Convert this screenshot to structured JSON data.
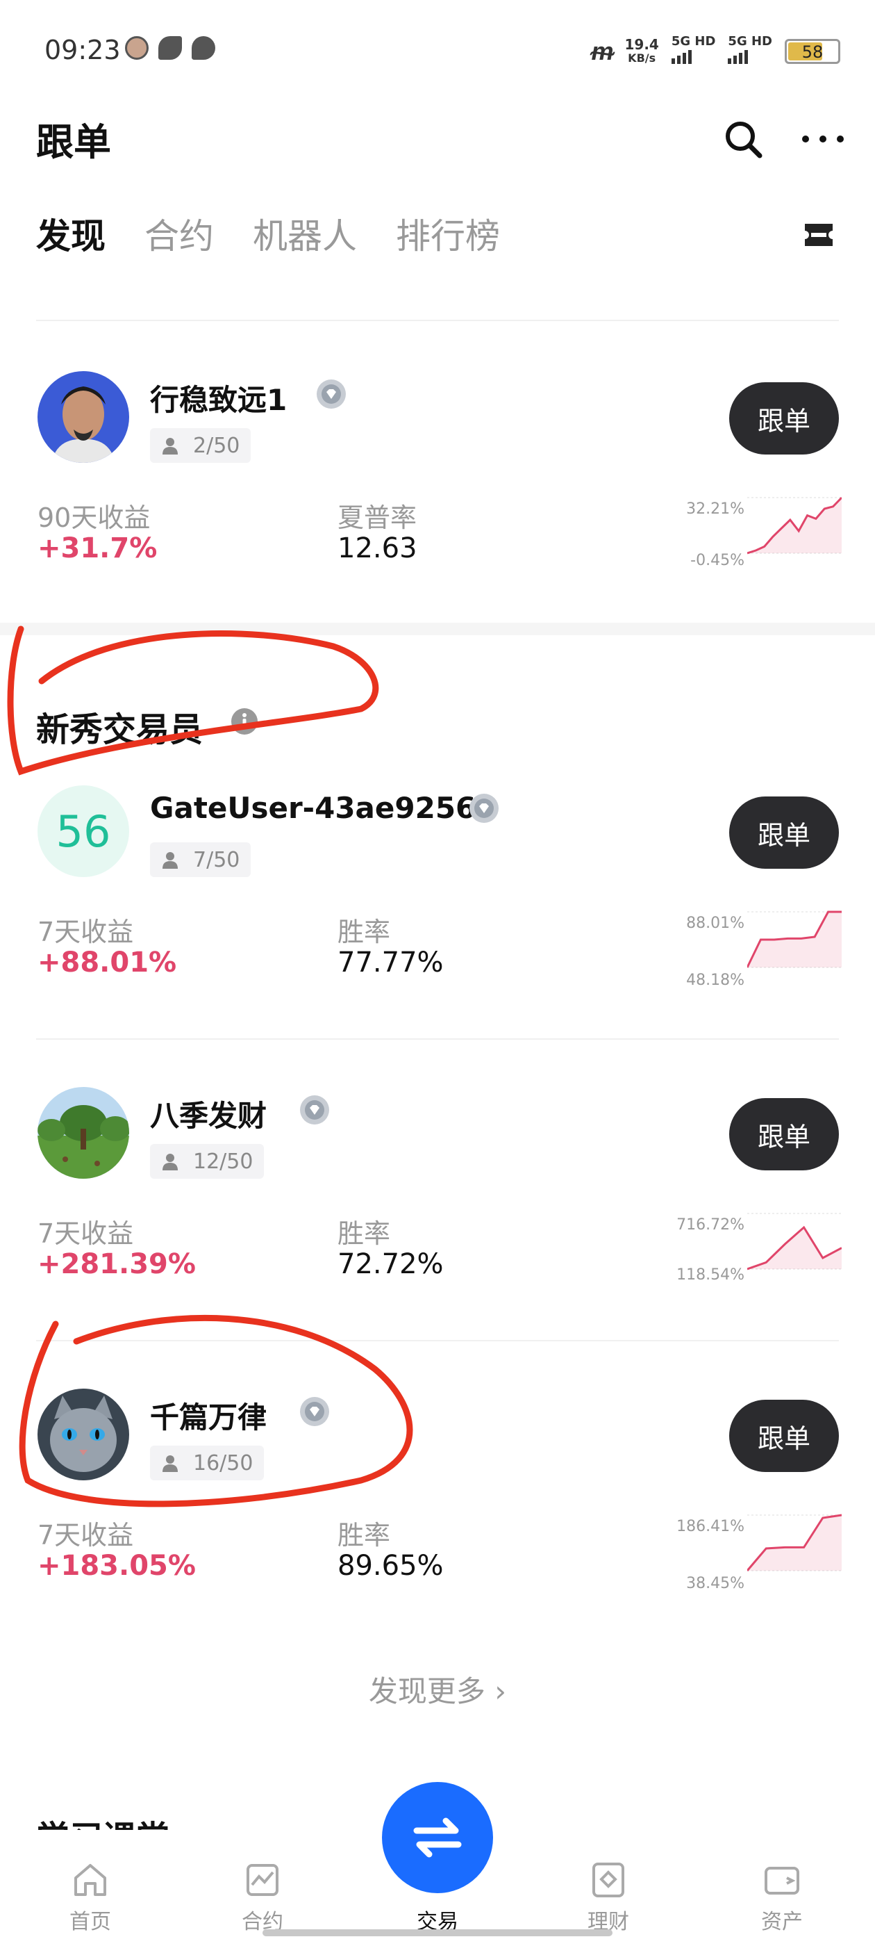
{
  "status_bar": {
    "time": "09:23",
    "speed_value": "19.4",
    "speed_unit": "KB/s",
    "network_1": "5G HD",
    "network_2": "5G HD",
    "battery": "58"
  },
  "header": {
    "title": "跟单"
  },
  "tabs": [
    {
      "label": "发现",
      "active": true
    },
    {
      "label": "合约",
      "active": false
    },
    {
      "label": "机器人",
      "active": false
    },
    {
      "label": "排行榜",
      "active": false
    }
  ],
  "top_trader": {
    "name": "行稳致远1",
    "followers": "2/50",
    "follow_label": "跟单",
    "stat1_label": "90天收益",
    "stat1_value": "+31.7%",
    "stat2_label": "夏普率",
    "stat2_value": "12.63",
    "spark_max": "32.21%",
    "spark_min": "-0.45%",
    "spark_series": [
      0,
      0.05,
      0.12,
      0.3,
      0.45,
      0.6,
      0.4,
      0.68,
      0.62,
      0.8,
      0.84,
      1.0
    ]
  },
  "newbie_section": {
    "title": "新秀交易员",
    "traders": [
      {
        "name": "GateUser-43ae9256",
        "avatar_text": "56",
        "followers": "7/50",
        "follow_label": "跟单",
        "stat1_label": "7天收益",
        "stat1_value": "+88.01%",
        "stat2_label": "胜率",
        "stat2_value": "77.77%",
        "spark_max": "88.01%",
        "spark_min": "48.18%",
        "spark_series": [
          0,
          0.5,
          0.5,
          0.52,
          0.52,
          0.55,
          1.0,
          1.0
        ]
      },
      {
        "name": "八季发财",
        "followers": "12/50",
        "follow_label": "跟单",
        "stat1_label": "7天收益",
        "stat1_value": "+281.39%",
        "stat2_label": "胜率",
        "stat2_value": "72.72%",
        "spark_max": "716.72%",
        "spark_min": "118.54%",
        "spark_series": [
          0,
          0.12,
          0.45,
          0.75,
          0.2,
          0.38
        ]
      },
      {
        "name": "千篇万律",
        "followers": "16/50",
        "follow_label": "跟单",
        "stat1_label": "7天收益",
        "stat1_value": "+183.05%",
        "stat2_label": "胜率",
        "stat2_value": "89.65%",
        "spark_max": "186.41%",
        "spark_min": "38.45%",
        "spark_series": [
          0,
          0.4,
          0.42,
          0.42,
          0.95,
          1.0
        ]
      }
    ]
  },
  "more_link": "发现更多 ›",
  "next_section_title": "学习课堂",
  "bottom_nav": [
    {
      "label": "首页"
    },
    {
      "label": "合约"
    },
    {
      "label": "交易",
      "active": true
    },
    {
      "label": "理财"
    },
    {
      "label": "资产"
    }
  ],
  "colors": {
    "accent_blue": "#1a6cff",
    "positive": "#e0456a",
    "button_dark": "#2b2b2e",
    "annotation_red": "#e8321e"
  }
}
